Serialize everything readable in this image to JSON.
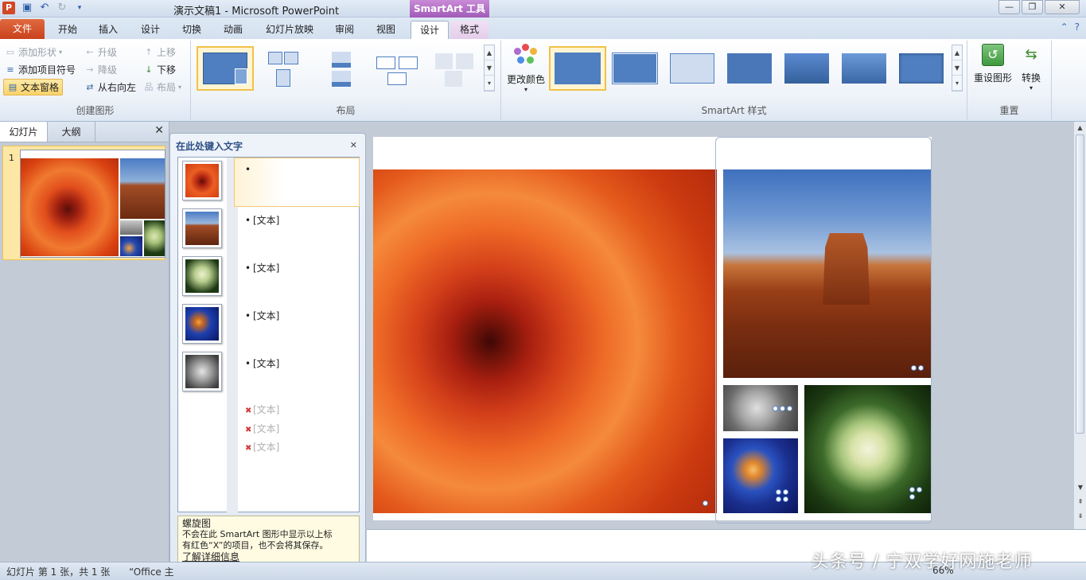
{
  "window": {
    "title": "演示文稿1 - Microsoft PowerPoint",
    "context_tab": "SmartArt 工具",
    "app_icon": "P"
  },
  "tabs": [
    {
      "label": "文件"
    },
    {
      "label": "开始"
    },
    {
      "label": "插入"
    },
    {
      "label": "设计"
    },
    {
      "label": "切换"
    },
    {
      "label": "动画"
    },
    {
      "label": "幻灯片放映"
    },
    {
      "label": "审阅"
    },
    {
      "label": "视图"
    },
    {
      "label": "设计"
    },
    {
      "label": "格式"
    }
  ],
  "ribbon": {
    "create": {
      "add_shape": "添加形状",
      "add_bullet": "添加项目符号",
      "text_pane": "文本窗格",
      "promote": "升级",
      "demote": "降级",
      "rtl": "从右向左",
      "move_up": "上移",
      "move_down": "下移",
      "layout": "布局",
      "label": "创建图形"
    },
    "layouts": {
      "label": "布局"
    },
    "styles": {
      "change_colors": "更改颜色",
      "label": "SmartArt 样式"
    },
    "reset": {
      "reset_graphic": "重设图形",
      "convert": "转换",
      "label": "重置"
    }
  },
  "left_pane": {
    "tab_slides": "幻灯片",
    "tab_outline": "大纲",
    "slide_number": "1"
  },
  "text_pane": {
    "title": "在此处键入文字",
    "items": [
      {
        "text": ""
      },
      {
        "text": "[文本]"
      },
      {
        "text": "[文本]"
      },
      {
        "text": "[文本]"
      },
      {
        "text": "[文本]"
      },
      {
        "text": "[文本]"
      },
      {
        "text": "[文本]"
      },
      {
        "text": "[文本]"
      }
    ],
    "info_title": "螺旋图",
    "info_line1": "不会在此 SmartArt 图形中显示以上标",
    "info_line2": "有红色“X”的项目，也不会将其保存。",
    "info_link": "了解详细信息"
  },
  "status": {
    "slide_info": "幻灯片 第 1 张，共 1 张",
    "theme": "“Office 主",
    "zoom": "66%"
  },
  "watermark": "头条号 / 宁双学好网施老师",
  "colors": {
    "accent": "#f1c24a",
    "file_tab": "#c9421d",
    "smartart_tab": "#a05ab8"
  }
}
